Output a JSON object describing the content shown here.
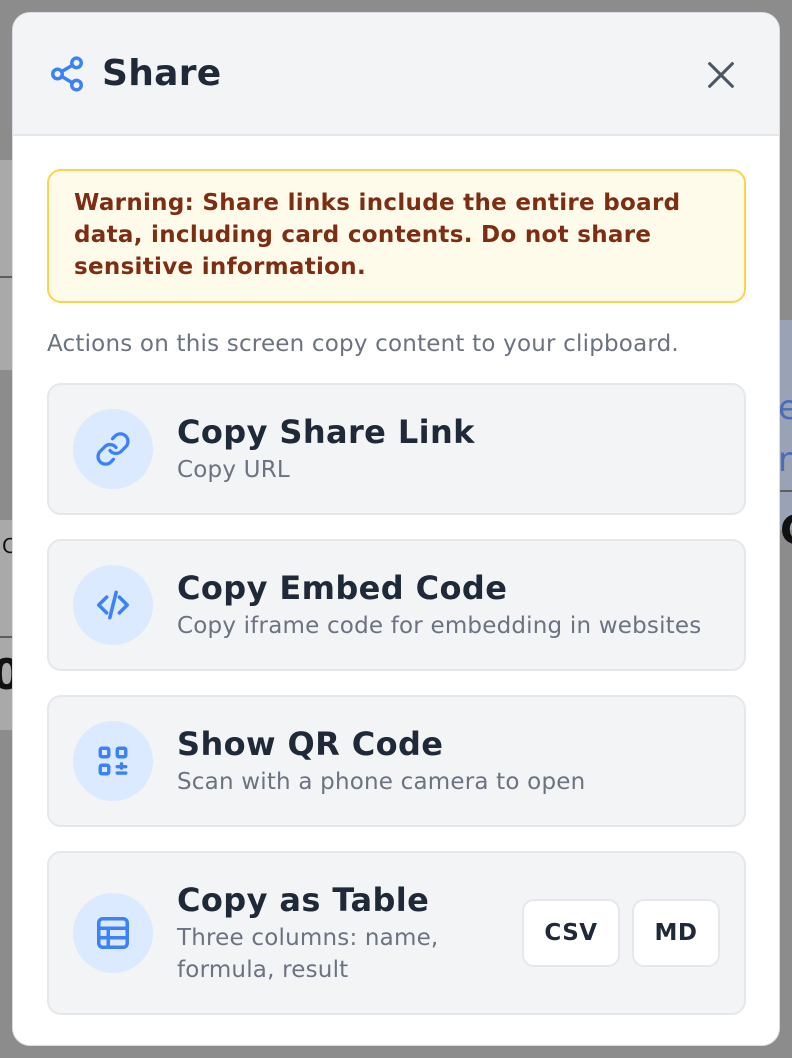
{
  "modal": {
    "title": "Share",
    "icons": {
      "header": "share-icon",
      "close": "close-icon"
    }
  },
  "warning": {
    "text": "Warning: Share links include the entire board data, including card contents. Do not share sensitive information."
  },
  "info": {
    "text": "Actions on this screen copy content to your clipboard."
  },
  "actions": [
    {
      "title": "Copy Share Link",
      "subtitle": "Copy URL",
      "icon": "link-icon"
    },
    {
      "title": "Copy Embed Code",
      "subtitle": "Copy iframe code for embedding in websites",
      "icon": "code-icon"
    },
    {
      "title": "Show QR Code",
      "subtitle": "Scan with a phone camera to open",
      "icon": "qr-code-icon"
    },
    {
      "title": "Copy as Table",
      "subtitle": "Three columns: name, formula, result",
      "icon": "table-icon",
      "buttons": [
        "CSV",
        "MD"
      ]
    }
  ],
  "colors": {
    "accent": "#3b82f6",
    "icon_bg": "#dbeafe",
    "warning_bg": "#fffbeb",
    "warning_border": "#fcd34d",
    "warning_text": "#7c2d12"
  },
  "background": {
    "fragments": [
      "e",
      "r",
      "C",
      "C",
      "0"
    ]
  }
}
